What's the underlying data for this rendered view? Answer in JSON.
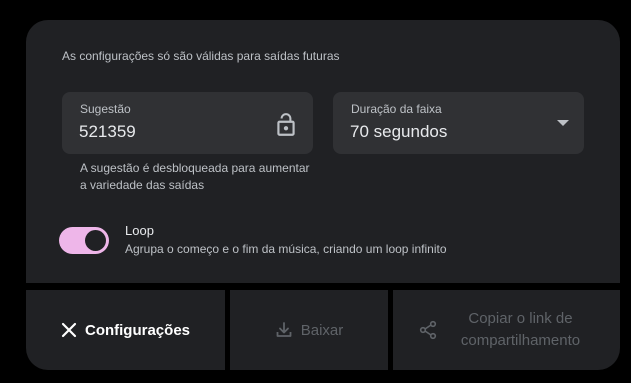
{
  "notice": "As configurações só são válidas para saídas futuras",
  "seed": {
    "label": "Sugestão",
    "value": "521359",
    "icon": "unlock-icon"
  },
  "duration": {
    "label": "Duração da faixa",
    "value": "70 segundos",
    "icon": "chevron-down-icon"
  },
  "seed_hint": "A sugestão é desbloqueada para aumentar a variedade das saídas",
  "loop": {
    "title": "Loop",
    "description": "Agrupa o começo e o fim da música, criando um loop infinito",
    "enabled": true
  },
  "actions": {
    "settings_label": "Configurações",
    "download_label": "Baixar",
    "share_label": "Copiar o link de compartilhamento"
  },
  "colors": {
    "toggle_on": "#eeb6e9",
    "panel": "#202124",
    "field": "#303134"
  }
}
